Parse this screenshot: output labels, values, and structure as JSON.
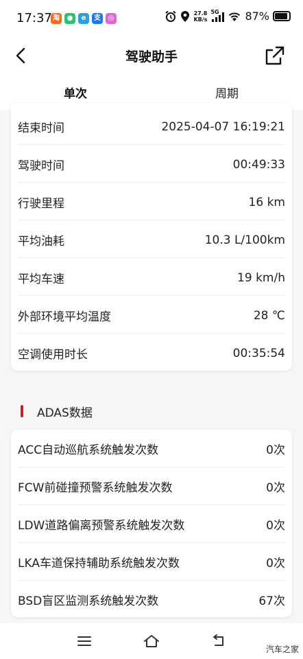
{
  "status_bar": {
    "time": "17:37",
    "notification_icons": [
      {
        "name": "taobao-icon",
        "glyph": "淘",
        "color": "#f56b1f"
      },
      {
        "name": "wechat-icon",
        "glyph": "●",
        "color": "#2dc26b"
      },
      {
        "name": "browser-icon",
        "glyph": "e",
        "color": "#2aa0e6"
      },
      {
        "name": "alipay-icon",
        "glyph": "支",
        "color": "#1677ff"
      },
      {
        "name": "gallery-icon",
        "glyph": "◎",
        "color": "#d86ad0"
      }
    ],
    "net_speed_value": "27.8",
    "net_speed_unit": "KB/s",
    "signal_label": "5G",
    "battery_percent": "87%",
    "battery_level": 0.87
  },
  "header": {
    "title": "驾驶助手"
  },
  "tabs": [
    {
      "label": "单次",
      "selected": true
    },
    {
      "label": "周期",
      "selected": false
    }
  ],
  "trip_details": [
    {
      "label": "结束时间",
      "value": "2025-04-07 16:19:21"
    },
    {
      "label": "驾驶时间",
      "value": "00:49:33"
    },
    {
      "label": "行驶里程",
      "value": "16 km"
    },
    {
      "label": "平均油耗",
      "value": "10.3 L/100km"
    },
    {
      "label": "平均车速",
      "value": "19 km/h"
    },
    {
      "label": "外部环境平均温度",
      "value": "28 ℃"
    },
    {
      "label": "空调使用时长",
      "value": "00:35:54"
    }
  ],
  "adas": {
    "section_title": "ADAS数据",
    "rows": [
      {
        "label": "ACC自动巡航系统触发次数",
        "value": "0次"
      },
      {
        "label": "FCW前碰撞预警系统触发次数",
        "value": "0次"
      },
      {
        "label": "LDW道路偏离预警系统触发次数",
        "value": "0次"
      },
      {
        "label": "LKA车道保持辅助系统触发次数",
        "value": "0次"
      },
      {
        "label": "BSD盲区监测系统触发次数",
        "value": "67次"
      }
    ]
  },
  "watermark": "汽车之家",
  "colors": {
    "accent": "#c0222e",
    "card_background": "#ffffff",
    "page_background": "#f6f6f6"
  }
}
